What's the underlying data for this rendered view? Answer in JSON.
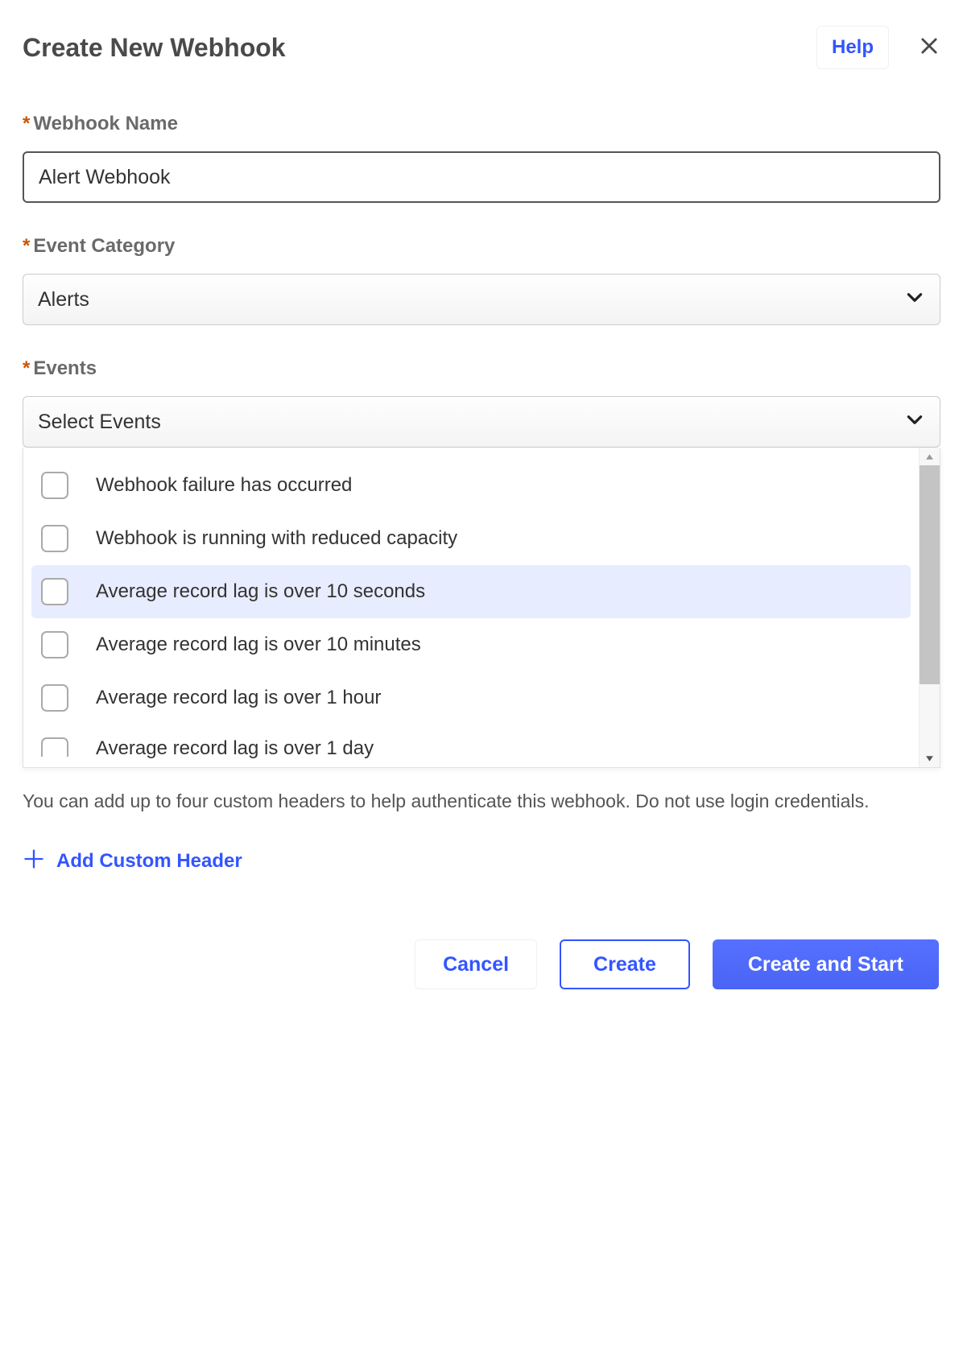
{
  "header": {
    "title": "Create New Webhook",
    "help_label": "Help"
  },
  "fields": {
    "webhook_name": {
      "label": "Webhook Name",
      "value": "Alert Webhook"
    },
    "event_category": {
      "label": "Event Category",
      "selected": "Alerts"
    },
    "events": {
      "label": "Events",
      "placeholder": "Select Events",
      "options": [
        {
          "label": "Webhook failure has occurred",
          "highlighted": false
        },
        {
          "label": "Webhook is running with reduced capacity",
          "highlighted": false
        },
        {
          "label": "Average record lag is over 10 seconds",
          "highlighted": true
        },
        {
          "label": "Average record lag is over 10 minutes",
          "highlighted": false
        },
        {
          "label": "Average record lag is over 1 hour",
          "highlighted": false
        },
        {
          "label": "Average record lag is over 1 day",
          "highlighted": false
        }
      ]
    }
  },
  "custom_headers": {
    "helper_text": "You can add up to four custom headers to help authenticate this webhook. Do not use login credentials.",
    "add_button_label": "Add Custom Header"
  },
  "footer": {
    "cancel_label": "Cancel",
    "create_label": "Create",
    "create_start_label": "Create and Start"
  }
}
